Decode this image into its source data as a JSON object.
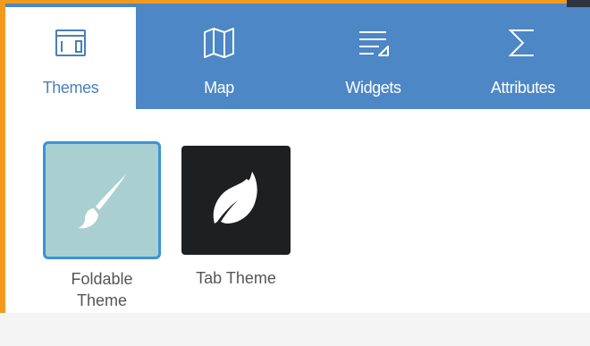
{
  "tabs": [
    {
      "label": "Themes",
      "icon": "themes-window-icon",
      "active": true
    },
    {
      "label": "Map",
      "icon": "map-icon",
      "active": false
    },
    {
      "label": "Widgets",
      "icon": "widgets-list-icon",
      "active": false
    },
    {
      "label": "Attributes",
      "icon": "sigma-icon",
      "active": false
    }
  ],
  "themes": [
    {
      "line1": "Foldable",
      "line2": "Theme",
      "icon": "paintbrush-icon",
      "selected": true
    },
    {
      "name": "Tab Theme",
      "icon": "leaf-icon",
      "selected": false
    }
  ],
  "colors": {
    "accent_blue": "#4d87c5",
    "selected_border": "#3a93d8",
    "foldable_thumb_bg": "#aacfd0",
    "tab_thumb_bg": "#1d1f21",
    "frame_orange": "#f29a1f"
  }
}
